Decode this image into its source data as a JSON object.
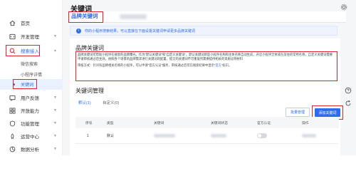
{
  "sidebar": {
    "items": [
      {
        "label": "首页",
        "icon": "home-icon"
      },
      {
        "label": "开发管理",
        "icon": "code-icon"
      },
      {
        "label": "搜索接入",
        "icon": "search-icon",
        "active": true
      },
      {
        "label": "微信搜索",
        "icon": "",
        "sub": true
      },
      {
        "label": "小程序详情",
        "icon": "",
        "sub": true
      },
      {
        "label": "关键词",
        "icon": "",
        "sub": true,
        "selected": true
      },
      {
        "label": "用户反馈",
        "icon": "chat-icon"
      },
      {
        "label": "开放能力",
        "icon": "grid-icon"
      },
      {
        "label": "功能管理",
        "icon": "shield-icon"
      },
      {
        "label": "运营中心",
        "icon": "rocket-icon"
      },
      {
        "label": "数据分析",
        "icon": "chart-icon"
      }
    ]
  },
  "main": {
    "title": "关键词",
    "tabs": [
      {
        "label": "品牌关键词"
      }
    ],
    "notice": "你的小程序搜索结果，可以直接在下面设置关键词申请更多品牌关键词",
    "brand_section": {
      "title": "品牌关键词",
      "desc_1": "品牌关键词可帮助小程序在搜索的品牌曝光，作为“默认关键词”和“自定义关键词”，默认关键词即是小程序名称和主体名称自动生成，开启小程序全体或在前往的常用名称，自定义关键词需要申请审核通过后生效，依照各个场景的品牌需求进行关键词的配置，提交的关键词不可重复所需要提供相关的资质证明材料",
      "desc_2": "审核方式：针对有品牌相关名称的小程序，可以申请“官方认证”服务，审核通过后可在搜索结果中显示",
      "desc_link": "“官方”",
      "desc_tail": "标识。"
    },
    "keyword_section": {
      "title": "关键词管理",
      "filter_default": "默认(1)",
      "filter_custom": "自定义(0)",
      "manage_button": "批量管理",
      "add_button": "添加关键词"
    },
    "table": {
      "headers": [
        "序号",
        "类型",
        "关键词",
        "关键词状态",
        "官方认证",
        "操作"
      ],
      "rows": [
        {
          "index": "1",
          "type": "默认",
          "keyword": "",
          "status": "",
          "official": false,
          "action": ""
        }
      ]
    }
  },
  "colors": {
    "accent": "#2f6bea",
    "highlight": "#e0232d"
  }
}
